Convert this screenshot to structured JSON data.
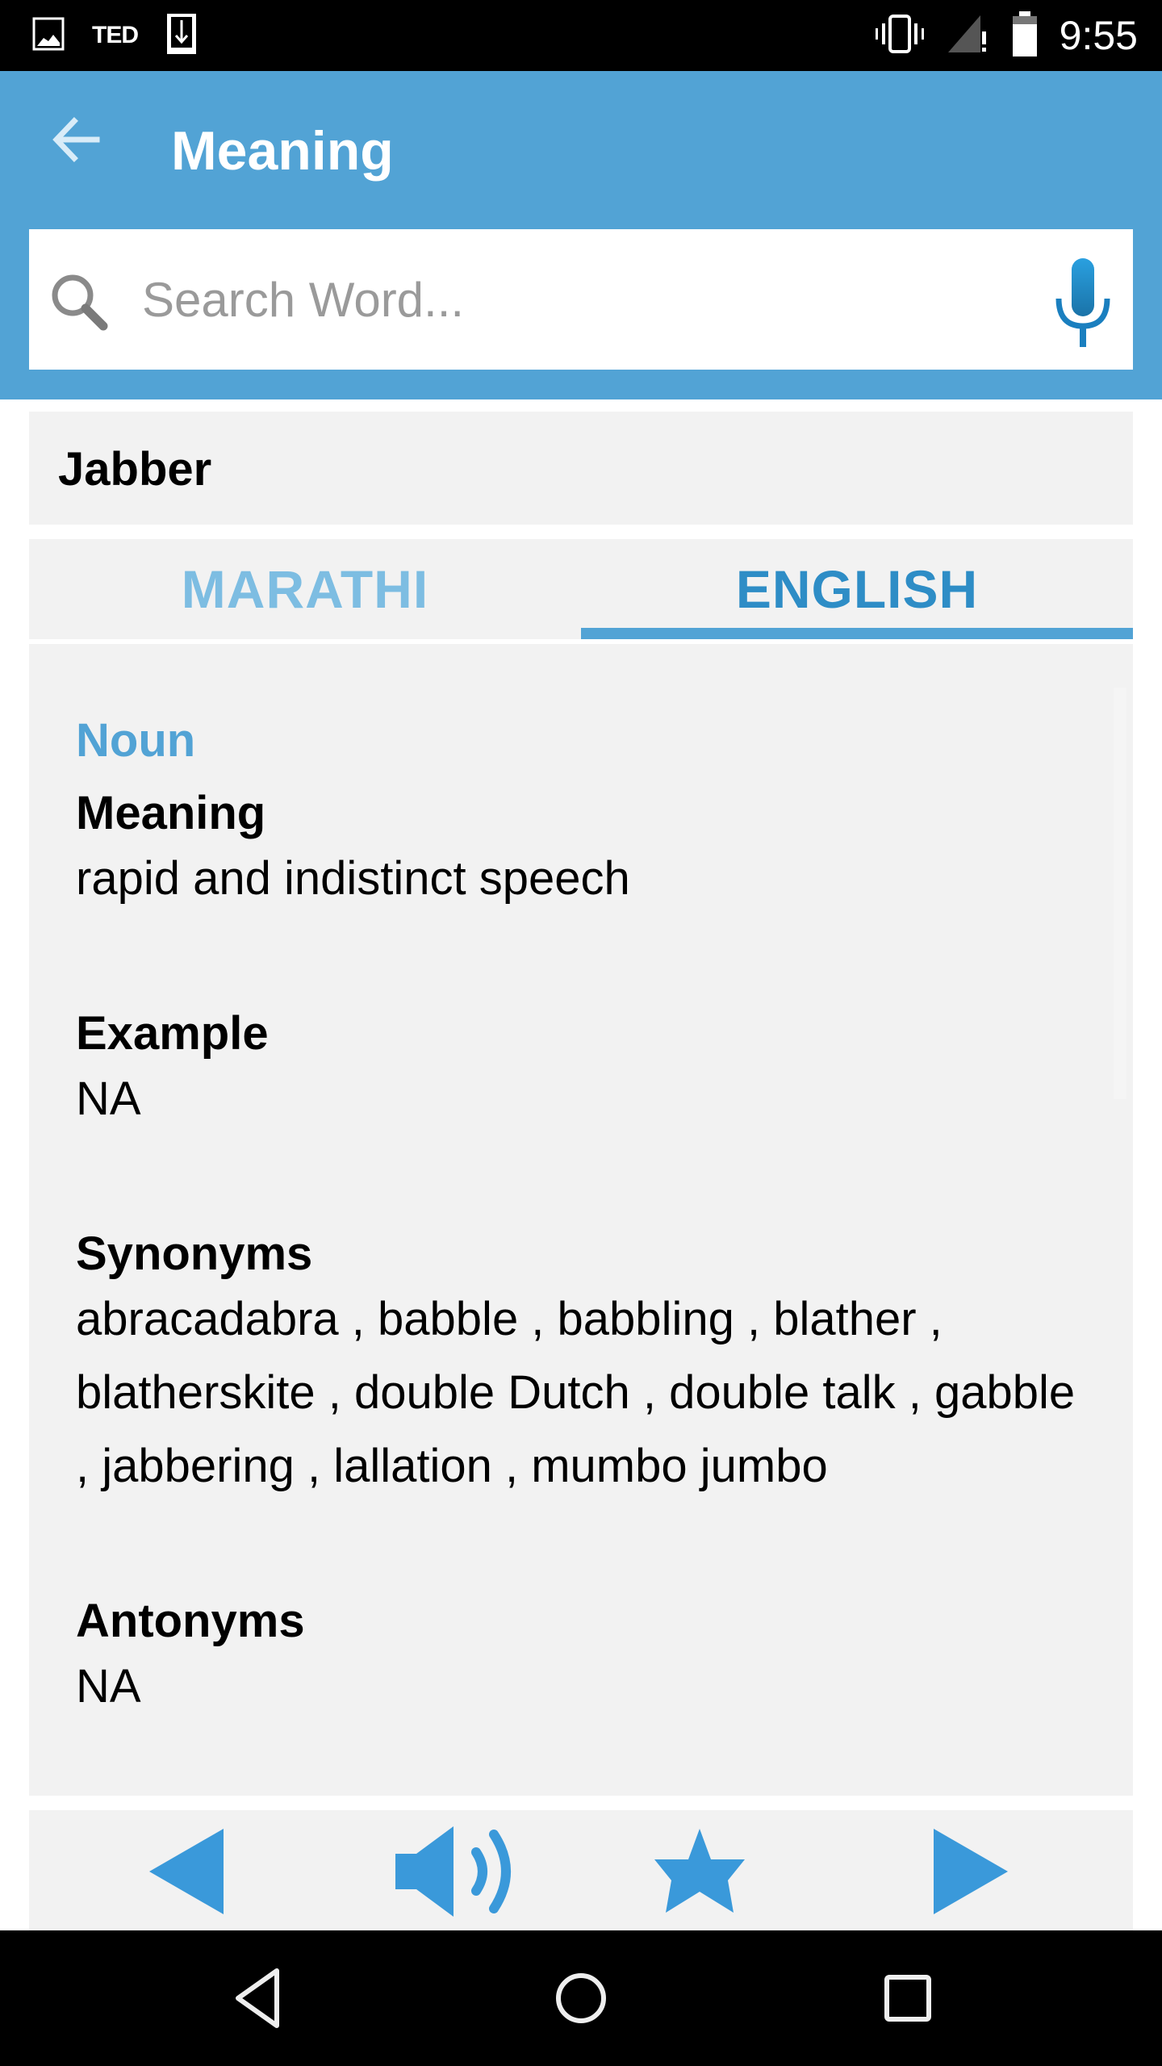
{
  "status_bar": {
    "left_icons": [
      "image-icon",
      "ted-app-icon",
      "download-icon"
    ],
    "ted_label": "TED",
    "right_icons": [
      "vibrate-icon",
      "signal-icon",
      "battery-icon"
    ],
    "time": "9:55"
  },
  "app_bar": {
    "back_icon": "arrow-left-icon",
    "title": "Meaning",
    "search": {
      "placeholder": "Search Word...",
      "value": "",
      "search_icon": "magnifier-icon",
      "mic_icon": "microphone-icon"
    }
  },
  "word": "Jabber",
  "tabs": [
    {
      "label": "MARATHI",
      "active": false
    },
    {
      "label": "ENGLISH",
      "active": true
    }
  ],
  "entry": {
    "part_of_speech": "Noun",
    "sections": [
      {
        "heading": "Meaning",
        "text": "rapid and indistinct speech"
      },
      {
        "heading": "Example",
        "text": "NA"
      },
      {
        "heading": "Synonyms",
        "text": "abracadabra , babble , babbling , blather , blatherskite , double Dutch , double talk , gabble , jabbering , lallation , mumbo jumbo"
      },
      {
        "heading": "Antonyms",
        "text": "NA"
      }
    ]
  },
  "toolbar": {
    "buttons": [
      {
        "name": "previous",
        "icon": "triangle-left-icon"
      },
      {
        "name": "speak",
        "icon": "speaker-icon"
      },
      {
        "name": "favorite",
        "icon": "star-icon"
      },
      {
        "name": "next",
        "icon": "triangle-right-icon"
      }
    ]
  },
  "nav_bar": {
    "buttons": [
      "back",
      "home",
      "recents"
    ]
  },
  "colors": {
    "primary": "#52A3D5",
    "tab_active": "#2E8DC6",
    "tab_inactive": "#7DBDE2",
    "icon_blue": "#3A99DA",
    "card_bg": "#F2F2F2"
  }
}
